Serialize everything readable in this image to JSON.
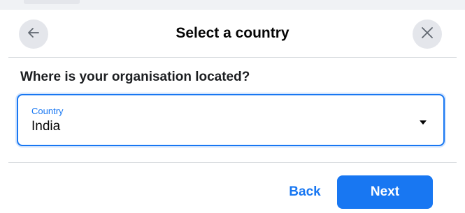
{
  "dialog": {
    "title": "Select a country",
    "back_icon": "arrow-left-icon",
    "close_icon": "close-icon"
  },
  "question": "Where is your organisation located?",
  "country_select": {
    "label": "Country",
    "value": "India",
    "caret_icon": "caret-down-icon"
  },
  "footer": {
    "back_label": "Back",
    "next_label": "Next"
  },
  "colors": {
    "accent": "#1877f2",
    "icon_button_bg": "#e4e6eb",
    "divider": "#dadde1"
  }
}
